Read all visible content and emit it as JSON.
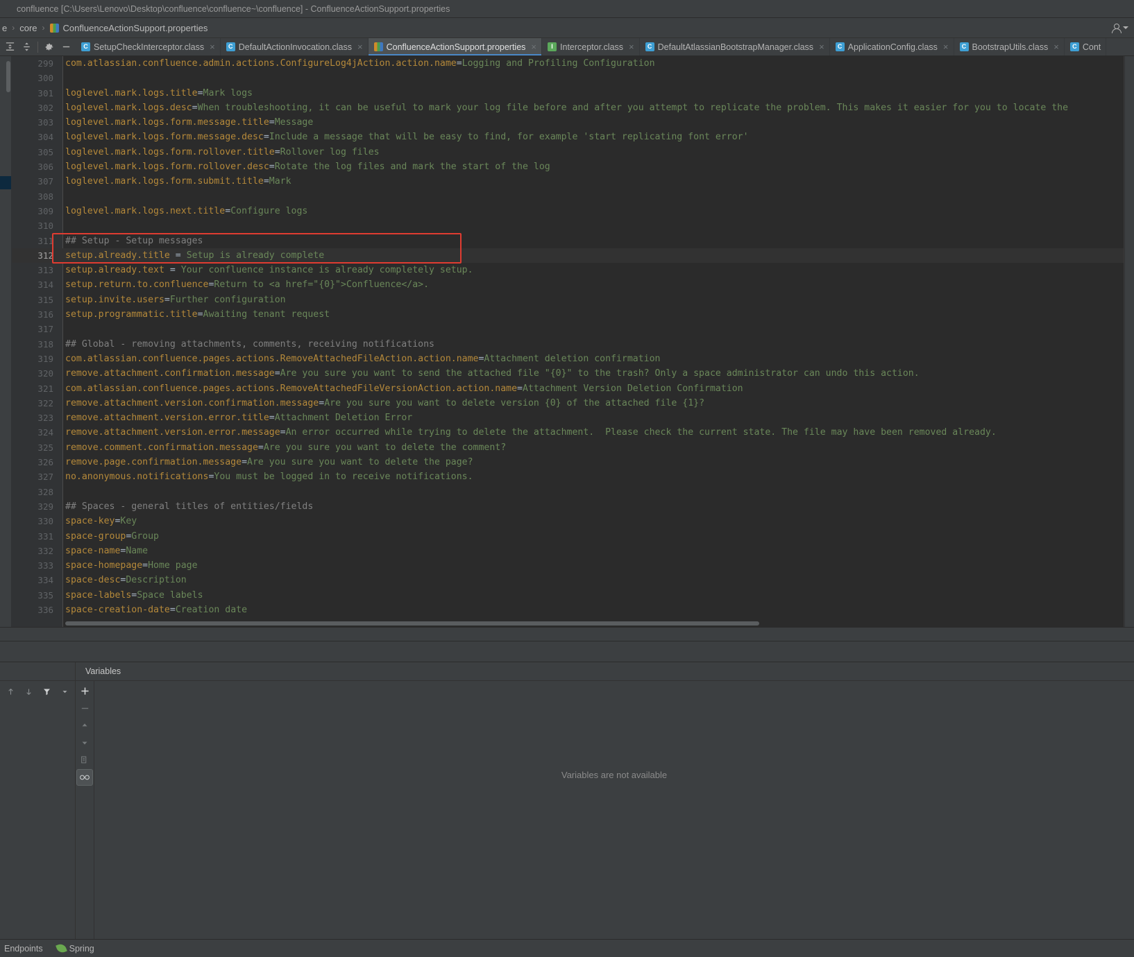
{
  "window": {
    "title": "confluence [C:\\Users\\Lenovo\\Desktop\\confluence\\confluence~\\confluence] - ConfluenceActionSupport.properties"
  },
  "navbar": {
    "crumbs": [
      {
        "label": "e",
        "icon": ""
      },
      {
        "label": "core",
        "icon": ""
      },
      {
        "label": "ConfluenceActionSupport.properties",
        "icon": "properties-file-icon"
      }
    ],
    "separator": "›",
    "account_icon": "person-icon",
    "account_caret": "chevron-down-icon"
  },
  "editor_toolbar": {
    "buttons": [
      {
        "name": "collapse-all-icon",
        "label": ""
      },
      {
        "name": "expand-all-icon",
        "label": ""
      },
      {
        "name": "settings-gear-icon",
        "label": ""
      },
      {
        "name": "hide-icon",
        "label": ""
      }
    ]
  },
  "tabs": [
    {
      "label": "SetupCheckInterceptor.class",
      "icon": "class",
      "active": false,
      "close": "×"
    },
    {
      "label": "DefaultActionInvocation.class",
      "icon": "class",
      "active": false,
      "close": "×"
    },
    {
      "label": "ConfluenceActionSupport.properties",
      "icon": "props",
      "active": true,
      "close": "×"
    },
    {
      "label": "Interceptor.class",
      "icon": "iface",
      "active": false,
      "close": "×"
    },
    {
      "label": "DefaultAtlassianBootstrapManager.class",
      "icon": "class",
      "active": false,
      "close": "×"
    },
    {
      "label": "ApplicationConfig.class",
      "icon": "class",
      "active": false,
      "close": "×"
    },
    {
      "label": "BootstrapUtils.class",
      "icon": "class",
      "active": false,
      "close": "×"
    },
    {
      "label": "Cont",
      "icon": "class",
      "active": false,
      "close": ""
    }
  ],
  "code": {
    "first_line_number": 299,
    "current_line": 312,
    "lines": [
      {
        "n": 299,
        "parts": [
          {
            "t": "k",
            "s": "com.atlassian.confluence.admin.actions.ConfigureLog4jAction.action.name"
          },
          {
            "t": "eq",
            "s": "="
          },
          {
            "t": "v",
            "s": "Logging and Profiling Configuration"
          }
        ]
      },
      {
        "n": 300,
        "parts": []
      },
      {
        "n": 301,
        "parts": [
          {
            "t": "k",
            "s": "loglevel.mark.logs.title"
          },
          {
            "t": "eq",
            "s": "="
          },
          {
            "t": "v",
            "s": "Mark logs"
          }
        ]
      },
      {
        "n": 302,
        "parts": [
          {
            "t": "k",
            "s": "loglevel.mark.logs.desc"
          },
          {
            "t": "eq",
            "s": "="
          },
          {
            "t": "v",
            "s": "When troubleshooting, it can be useful to mark your log file before and after you attempt to replicate the problem. This makes it easier for you to locate the"
          }
        ]
      },
      {
        "n": 303,
        "parts": [
          {
            "t": "k",
            "s": "loglevel.mark.logs.form.message.title"
          },
          {
            "t": "eq",
            "s": "="
          },
          {
            "t": "v",
            "s": "Message"
          }
        ]
      },
      {
        "n": 304,
        "parts": [
          {
            "t": "k",
            "s": "loglevel.mark.logs.form.message.desc"
          },
          {
            "t": "eq",
            "s": "="
          },
          {
            "t": "v",
            "s": "Include a message that will be easy to find, for example 'start replicating font error'"
          }
        ]
      },
      {
        "n": 305,
        "parts": [
          {
            "t": "k",
            "s": "loglevel.mark.logs.form.rollover.title"
          },
          {
            "t": "eq",
            "s": "="
          },
          {
            "t": "v",
            "s": "Rollover log files"
          }
        ]
      },
      {
        "n": 306,
        "parts": [
          {
            "t": "k",
            "s": "loglevel.mark.logs.form.rollover.desc"
          },
          {
            "t": "eq",
            "s": "="
          },
          {
            "t": "v",
            "s": "Rotate the log files and mark the start of the log"
          }
        ]
      },
      {
        "n": 307,
        "parts": [
          {
            "t": "k",
            "s": "loglevel.mark.logs.form.submit.title"
          },
          {
            "t": "eq",
            "s": "="
          },
          {
            "t": "v",
            "s": "Mark"
          }
        ]
      },
      {
        "n": 308,
        "parts": []
      },
      {
        "n": 309,
        "parts": [
          {
            "t": "k",
            "s": "loglevel.mark.logs.next.title"
          },
          {
            "t": "eq",
            "s": "="
          },
          {
            "t": "v",
            "s": "Configure logs"
          }
        ]
      },
      {
        "n": 310,
        "parts": []
      },
      {
        "n": 311,
        "parts": [
          {
            "t": "cm",
            "s": "## Setup - Setup messages"
          }
        ]
      },
      {
        "n": 312,
        "parts": [
          {
            "t": "k",
            "s": "setup.already.title "
          },
          {
            "t": "eq",
            "s": "= "
          },
          {
            "t": "v",
            "s": "Setup is already complete"
          }
        ]
      },
      {
        "n": 313,
        "parts": [
          {
            "t": "k",
            "s": "setup.already.text "
          },
          {
            "t": "eq",
            "s": "= "
          },
          {
            "t": "v",
            "s": "Your confluence instance is already completely setup."
          }
        ]
      },
      {
        "n": 314,
        "parts": [
          {
            "t": "k",
            "s": "setup.return.to.confluence"
          },
          {
            "t": "eq",
            "s": "="
          },
          {
            "t": "v",
            "s": "Return to <a href=\"{0}\">Confluence</a>."
          }
        ]
      },
      {
        "n": 315,
        "parts": [
          {
            "t": "k",
            "s": "setup.invite.users"
          },
          {
            "t": "eq",
            "s": "="
          },
          {
            "t": "v",
            "s": "Further configuration"
          }
        ]
      },
      {
        "n": 316,
        "parts": [
          {
            "t": "k",
            "s": "setup.programmatic.title"
          },
          {
            "t": "eq",
            "s": "="
          },
          {
            "t": "v",
            "s": "Awaiting tenant request"
          }
        ]
      },
      {
        "n": 317,
        "parts": []
      },
      {
        "n": 318,
        "parts": [
          {
            "t": "cm",
            "s": "## Global - removing attachments, comments, receiving notifications"
          }
        ]
      },
      {
        "n": 319,
        "parts": [
          {
            "t": "k",
            "s": "com.atlassian.confluence.pages.actions.RemoveAttachedFileAction.action.name"
          },
          {
            "t": "eq",
            "s": "="
          },
          {
            "t": "v",
            "s": "Attachment deletion confirmation"
          }
        ]
      },
      {
        "n": 320,
        "parts": [
          {
            "t": "k",
            "s": "remove.attachment.confirmation.message"
          },
          {
            "t": "eq",
            "s": "="
          },
          {
            "t": "v",
            "s": "Are you sure you want to send the attached file \"{0}\" to the trash? Only a space administrator can undo this action."
          }
        ]
      },
      {
        "n": 321,
        "parts": [
          {
            "t": "k",
            "s": "com.atlassian.confluence.pages.actions.RemoveAttachedFileVersionAction.action.name"
          },
          {
            "t": "eq",
            "s": "="
          },
          {
            "t": "v",
            "s": "Attachment Version Deletion Confirmation"
          }
        ]
      },
      {
        "n": 322,
        "parts": [
          {
            "t": "k",
            "s": "remove.attachment.version.confirmation.message"
          },
          {
            "t": "eq",
            "s": "="
          },
          {
            "t": "v",
            "s": "Are you sure you want to delete version {0} of the attached file {1}?"
          }
        ]
      },
      {
        "n": 323,
        "parts": [
          {
            "t": "k",
            "s": "remove.attachment.version.error.title"
          },
          {
            "t": "eq",
            "s": "="
          },
          {
            "t": "v",
            "s": "Attachment Deletion Error"
          }
        ]
      },
      {
        "n": 324,
        "parts": [
          {
            "t": "k",
            "s": "remove.attachment.version.error.message"
          },
          {
            "t": "eq",
            "s": "="
          },
          {
            "t": "v",
            "s": "An error occurred while trying to delete the attachment.  Please check the current state. The file may have been removed already."
          }
        ]
      },
      {
        "n": 325,
        "parts": [
          {
            "t": "k",
            "s": "remove.comment.confirmation.message"
          },
          {
            "t": "eq",
            "s": "="
          },
          {
            "t": "v",
            "s": "Are you sure you want to delete the comment?"
          }
        ]
      },
      {
        "n": 326,
        "parts": [
          {
            "t": "k",
            "s": "remove.page.confirmation.message"
          },
          {
            "t": "eq",
            "s": "="
          },
          {
            "t": "v",
            "s": "Are you sure you want to delete the page?"
          }
        ]
      },
      {
        "n": 327,
        "parts": [
          {
            "t": "k",
            "s": "no.anonymous.notifications"
          },
          {
            "t": "eq",
            "s": "="
          },
          {
            "t": "v",
            "s": "You must be logged in to receive notifications."
          }
        ]
      },
      {
        "n": 328,
        "parts": []
      },
      {
        "n": 329,
        "parts": [
          {
            "t": "cm",
            "s": "## Spaces - general titles of entities/fields"
          }
        ]
      },
      {
        "n": 330,
        "parts": [
          {
            "t": "k",
            "s": "space-key"
          },
          {
            "t": "eq",
            "s": "="
          },
          {
            "t": "v",
            "s": "Key"
          }
        ]
      },
      {
        "n": 331,
        "parts": [
          {
            "t": "k",
            "s": "space-group"
          },
          {
            "t": "eq",
            "s": "="
          },
          {
            "t": "v",
            "s": "Group"
          }
        ]
      },
      {
        "n": 332,
        "parts": [
          {
            "t": "k",
            "s": "space-name"
          },
          {
            "t": "eq",
            "s": "="
          },
          {
            "t": "v",
            "s": "Name"
          }
        ]
      },
      {
        "n": 333,
        "parts": [
          {
            "t": "k",
            "s": "space-homepage"
          },
          {
            "t": "eq",
            "s": "="
          },
          {
            "t": "v",
            "s": "Home page"
          }
        ]
      },
      {
        "n": 334,
        "parts": [
          {
            "t": "k",
            "s": "space-desc"
          },
          {
            "t": "eq",
            "s": "="
          },
          {
            "t": "v",
            "s": "Description"
          }
        ]
      },
      {
        "n": 335,
        "parts": [
          {
            "t": "k",
            "s": "space-labels"
          },
          {
            "t": "eq",
            "s": "="
          },
          {
            "t": "v",
            "s": "Space labels"
          }
        ]
      },
      {
        "n": 336,
        "parts": [
          {
            "t": "k",
            "s": "space-creation-date"
          },
          {
            "t": "eq",
            "s": "="
          },
          {
            "t": "v",
            "s": "Creation date"
          }
        ]
      }
    ]
  },
  "annotation": {
    "color": "#e03c31",
    "covers_lines": [
      311,
      312
    ]
  },
  "debugger": {
    "panel_title": "Variables",
    "empty_message": "Variables are not available",
    "left_toolbar": [
      {
        "name": "step-up-icon",
        "glyph": "↑"
      },
      {
        "name": "step-down-icon",
        "glyph": "↓"
      },
      {
        "name": "filter-icon",
        "glyph": "filter"
      },
      {
        "name": "dropdown-caret-icon",
        "glyph": "▾"
      }
    ],
    "side_toolbar": [
      {
        "name": "add-watch-icon",
        "glyph": "+"
      },
      {
        "name": "remove-watch-icon",
        "glyph": "—"
      },
      {
        "name": "move-up-icon",
        "glyph": "▲"
      },
      {
        "name": "move-down-icon",
        "glyph": "▼"
      },
      {
        "name": "copy-icon",
        "glyph": "copy"
      },
      {
        "name": "inspect-glasses-icon",
        "glyph": "∞",
        "selected": true
      }
    ]
  },
  "statusbar": {
    "items": [
      {
        "label": "Endpoints",
        "icon": ""
      },
      {
        "label": "Spring",
        "icon": "spring-leaf-icon"
      }
    ]
  },
  "colors": {
    "background": "#3c3f41",
    "editor_bg": "#2b2b2b",
    "gutter_bg": "#313335",
    "key": "#b5893a",
    "value": "#6a8759",
    "comment": "#808080",
    "separator": "#a9b7c6",
    "accent": "#4a88c7",
    "annotation": "#e03c31",
    "selection": "#0d293e"
  }
}
